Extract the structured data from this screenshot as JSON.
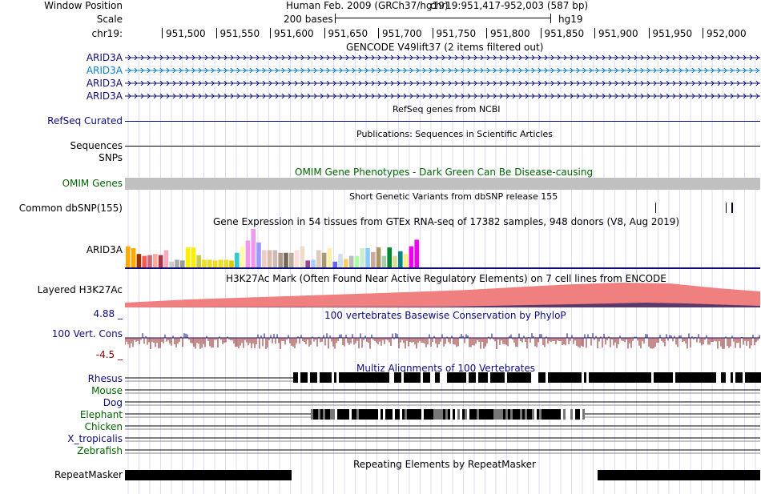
{
  "header": {
    "window_position_label": "Window Position",
    "scale_label": "Scale",
    "chrom_label": "chr19:",
    "assembly": "Human Feb. 2009 (GRCh37/hg19)",
    "position": "chr19:951,417-952,003 (587 bp)",
    "scale_text": "200 bases",
    "db": "hg19",
    "ruler_ticks": [
      "951,500",
      "951,550",
      "951,600",
      "951,650",
      "951,700",
      "951,750",
      "951,800",
      "951,850",
      "951,900",
      "951,950",
      "952,000"
    ]
  },
  "tracks": {
    "gencode": {
      "title": "GENCODE V49lift37 (2 items filtered out)",
      "items": [
        "ARID3A",
        "ARID3A",
        "ARID3A",
        "ARID3A"
      ],
      "item_colors": [
        "#0c0c78",
        "#0c7ccf",
        "#0c0c78",
        "#0c0c78"
      ]
    },
    "refseq": {
      "title": "RefSeq genes from NCBI",
      "label": "RefSeq Curated"
    },
    "publications": {
      "title": "Publications: Sequences in Scientific Articles",
      "label": "Sequences"
    },
    "snps": {
      "label": "SNPs"
    },
    "omim": {
      "title": "OMIM Gene Phenotypes - Dark Green Can Be Disease-causing",
      "label": "OMIM Genes"
    },
    "dbsnp": {
      "title": "Short Genetic Variants from dbSNP release 155",
      "label": "Common dbSNP(155)"
    },
    "gtex": {
      "title": "Gene Expression in 54 tissues from GTEx RNA-seq of 17382 samples, 948 donors (V8, Aug 2019)",
      "label": "ARID3A",
      "values": [
        0.55,
        0.5,
        0.35,
        0.3,
        0.32,
        0.35,
        0.32,
        0.45,
        0.15,
        0.2,
        0.18,
        0.52,
        0.52,
        0.32,
        0.2,
        0.2,
        0.18,
        0.2,
        0.2,
        0.18,
        0.38,
        0.55,
        0.7,
        1.0,
        0.65,
        0.45,
        0.45,
        0.45,
        0.38,
        0.38,
        0.38,
        0.45,
        0.55,
        0.18,
        0.2,
        0.45,
        0.38,
        0.5,
        0.15,
        0.35,
        0.22,
        0.3,
        0.3,
        0.5,
        0.5,
        0.4,
        0.52,
        0.3,
        0.52,
        0.3,
        0.42,
        0.35,
        0.55,
        0.72
      ],
      "colors": [
        "#ffaa00",
        "#ffaa00",
        "#993300",
        "#ff5555",
        "#cc6677",
        "#ffaa99",
        "#aa3344",
        "#ffaabb",
        "#ccc",
        "#aaa",
        "#999",
        "#ffee00",
        "#ffee00",
        "#cccc44",
        "#eedd22",
        "#eedd22",
        "#eedd22",
        "#eedd22",
        "#eedd22",
        "#ddcc00",
        "#33cccc",
        "#ffffaa",
        "#ee99ee",
        "#ee99ee",
        "#9999ff",
        "#eecccc",
        "#ddbbaa",
        "#ccbbbb",
        "#aa9988",
        "#776655",
        "#bbaa99",
        "#ffdddd",
        "#eeddcc",
        "#994499",
        "#aaccff",
        "#ddccbb",
        "#aa9977",
        "#ffeeaa",
        "#6666ff",
        "#ccddee",
        "#ffcc66",
        "#bbbbbb",
        "#aaffaa",
        "#cceecc",
        "#88ccff",
        "#ccaa99",
        "#aa9966",
        "#aaccaa",
        "#008833",
        "#dddd99",
        "#008888",
        "#ffee88",
        "#ee00ee",
        "#ee00ee"
      ]
    },
    "h3k27ac": {
      "title": "H3K27Ac Mark (Often Found Near Active Regulatory Elements) on 7 cell lines from ENCODE",
      "label": "Layered H3K27Ac"
    },
    "conservation": {
      "title": "100 vertebrates Basewise Conservation by PhyloP",
      "label": "100 Vert. Cons",
      "max": "4.88 _",
      "min": "-4.5 _"
    },
    "multiz": {
      "title": "Multiz Alignments of 100 Vertebrates",
      "species": [
        {
          "name": "Rhesus",
          "color": "#0c0c78"
        },
        {
          "name": "Mouse",
          "color": "#006400"
        },
        {
          "name": "Dog",
          "color": "#0c0c78"
        },
        {
          "name": "Elephant",
          "color": "#006400"
        },
        {
          "name": "Chicken",
          "color": "#006400"
        },
        {
          "name": "X_tropicalis",
          "color": "#0c0c78"
        },
        {
          "name": "Zebrafish",
          "color": "#006400"
        }
      ]
    },
    "repeatmasker": {
      "title": "Repeating Elements by RepeatMasker",
      "label": "RepeatMasker"
    }
  },
  "colors": {
    "navy": "#0c0c78",
    "dark_green": "#006400",
    "omim_bar": "#c0c0c0",
    "h3k27ac_fill": "#f08080",
    "grid": "#d8d8f0"
  }
}
